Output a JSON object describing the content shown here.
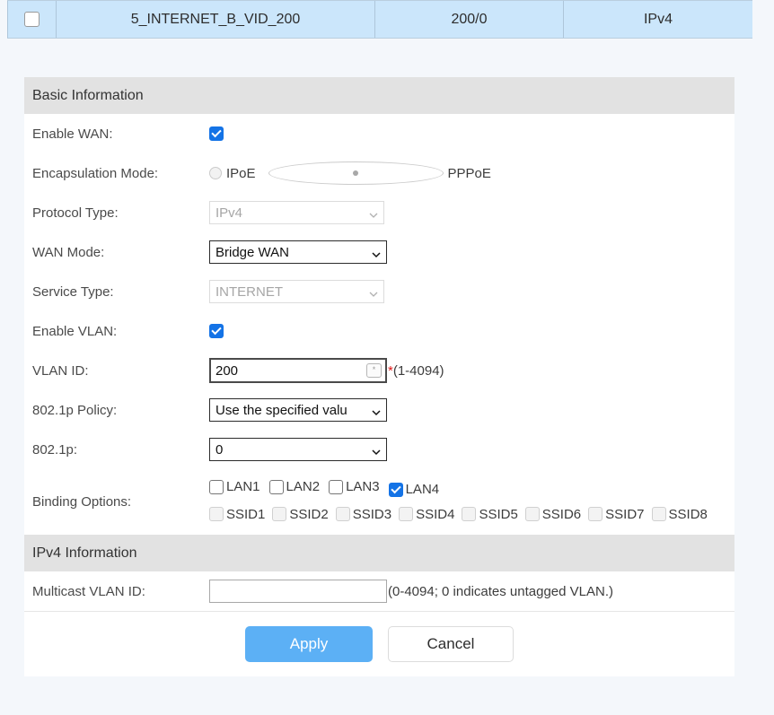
{
  "connection_row": {
    "checkbox_checked": false,
    "name": "5_INTERNET_B_VID_200",
    "vlan_priority": "200/0",
    "protocol": "IPv4"
  },
  "basic_section": {
    "title": "Basic Information",
    "enable_wan": {
      "label": "Enable WAN:",
      "checked": true
    },
    "encapsulation_mode": {
      "label": "Encapsulation Mode:",
      "options": [
        "IPoE",
        "PPPoE"
      ],
      "selected": "PPPoE",
      "disabled": true
    },
    "protocol_type": {
      "label": "Protocol Type:",
      "value": "IPv4",
      "disabled": true
    },
    "wan_mode": {
      "label": "WAN Mode:",
      "value": "Bridge WAN",
      "disabled": false
    },
    "service_type": {
      "label": "Service Type:",
      "value": "INTERNET",
      "disabled": true
    },
    "enable_vlan": {
      "label": "Enable VLAN:",
      "checked": true
    },
    "vlan_id": {
      "label": "VLAN ID:",
      "value": "200",
      "required_mark": "*",
      "hint": "(1-4094)"
    },
    "dot1p_policy": {
      "label": "802.1p Policy:",
      "value": "Use the specified valu"
    },
    "dot1p": {
      "label": "802.1p:",
      "value": "0"
    },
    "binding_options": {
      "label": "Binding Options:",
      "items": [
        {
          "label": "LAN1",
          "checked": false,
          "disabled": false
        },
        {
          "label": "LAN2",
          "checked": false,
          "disabled": false
        },
        {
          "label": "LAN3",
          "checked": false,
          "disabled": false
        },
        {
          "label": "LAN4",
          "checked": true,
          "disabled": false
        },
        {
          "label": "SSID1",
          "checked": false,
          "disabled": true
        },
        {
          "label": "SSID2",
          "checked": false,
          "disabled": true
        },
        {
          "label": "SSID3",
          "checked": false,
          "disabled": true
        },
        {
          "label": "SSID4",
          "checked": false,
          "disabled": true
        },
        {
          "label": "SSID5",
          "checked": false,
          "disabled": true
        },
        {
          "label": "SSID6",
          "checked": false,
          "disabled": true
        },
        {
          "label": "SSID7",
          "checked": false,
          "disabled": true
        },
        {
          "label": "SSID8",
          "checked": false,
          "disabled": true
        }
      ]
    }
  },
  "ipv4_section": {
    "title": "IPv4 Information",
    "multicast_vlan_id": {
      "label": "Multicast VLAN ID:",
      "value": "",
      "hint": "(0-4094; 0 indicates untagged VLAN.)"
    }
  },
  "footer": {
    "apply_label": "Apply",
    "cancel_label": "Cancel"
  },
  "colors": {
    "accent_blue": "#5cb0f5",
    "checkbox_blue": "#1473e6",
    "row_blue": "#cbe6fb",
    "section_gray": "#e2e2e2",
    "page_bg": "#f4f7fb",
    "required_red": "#e01b1b"
  }
}
